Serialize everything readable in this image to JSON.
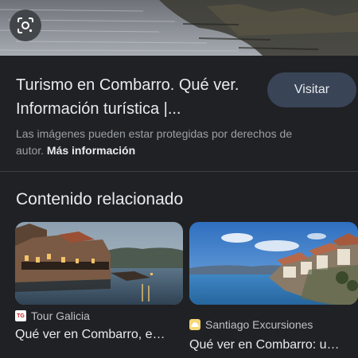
{
  "result": {
    "title": "Turismo en Combarro. Qué ver. Información turística |...",
    "visit_label": "Visitar",
    "copyright_text": "Las imágenes pueden estar protegidas por derechos de autor.",
    "more_info_label": "Más información"
  },
  "related": {
    "heading": "Contenido relacionado",
    "cards": [
      {
        "source": "Tour Galicia",
        "favicon": "tour-galicia-logo",
        "favicon_text": "TG",
        "title": "Qué ver en Combarro, e…"
      },
      {
        "source": "Santiago Excursiones",
        "favicon": "santiago-excursiones-logo",
        "favicon_text": "SE",
        "title": "Qué ver en Combarro: u…"
      }
    ]
  },
  "colors": {
    "background": "#202124",
    "button": "#394457",
    "secondary_text": "#9aa0a6"
  },
  "icons": {
    "lens": "google-lens-icon"
  }
}
